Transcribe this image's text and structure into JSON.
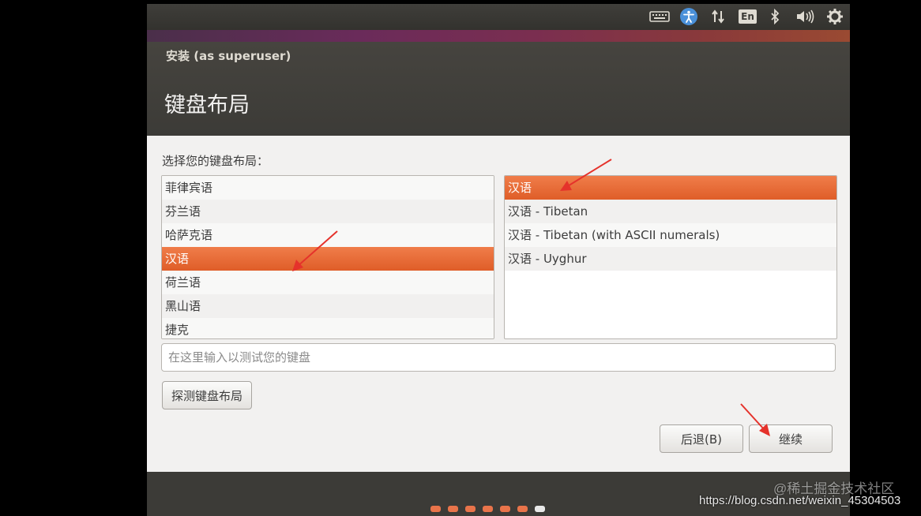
{
  "top_panel": {
    "indicators": [
      "keyboard-icon",
      "accessibility-icon",
      "network-icon",
      "keyboard-layout-indicator",
      "bluetooth-icon",
      "volume-icon",
      "gear-icon"
    ],
    "keyboard_indicator_label": "En"
  },
  "window": {
    "title": "安装 (as superuser)",
    "page_title": "键盘布局"
  },
  "content": {
    "choose_label": "选择您的键盘布局：",
    "languages": [
      {
        "label": "菲律宾语"
      },
      {
        "label": "芬兰语"
      },
      {
        "label": "哈萨克语"
      },
      {
        "label": "汉语",
        "selected": true
      },
      {
        "label": "荷兰语"
      },
      {
        "label": "黑山语"
      },
      {
        "label": "捷克"
      }
    ],
    "variants": [
      {
        "label": "汉语",
        "selected": true
      },
      {
        "label": "汉语 - Tibetan"
      },
      {
        "label": "汉语 - Tibetan (with ASCII numerals)"
      },
      {
        "label": "汉语 - Uyghur"
      }
    ],
    "test_input_placeholder": "在这里输入以测试您的键盘",
    "test_input_value": "",
    "detect_button": "探测键盘布局",
    "back_button": "后退(B)",
    "continue_button": "继续"
  },
  "footer": {
    "progress_steps_total": 7,
    "progress_current_step": 7
  },
  "watermark": {
    "line1": "@稀土掘金技术社区",
    "line2": "https://blog.csdn.net/weixin_45304503"
  },
  "colors": {
    "accent": "#df5d28",
    "annotation_arrow": "#e5322b",
    "panel": "#3c3b37"
  }
}
